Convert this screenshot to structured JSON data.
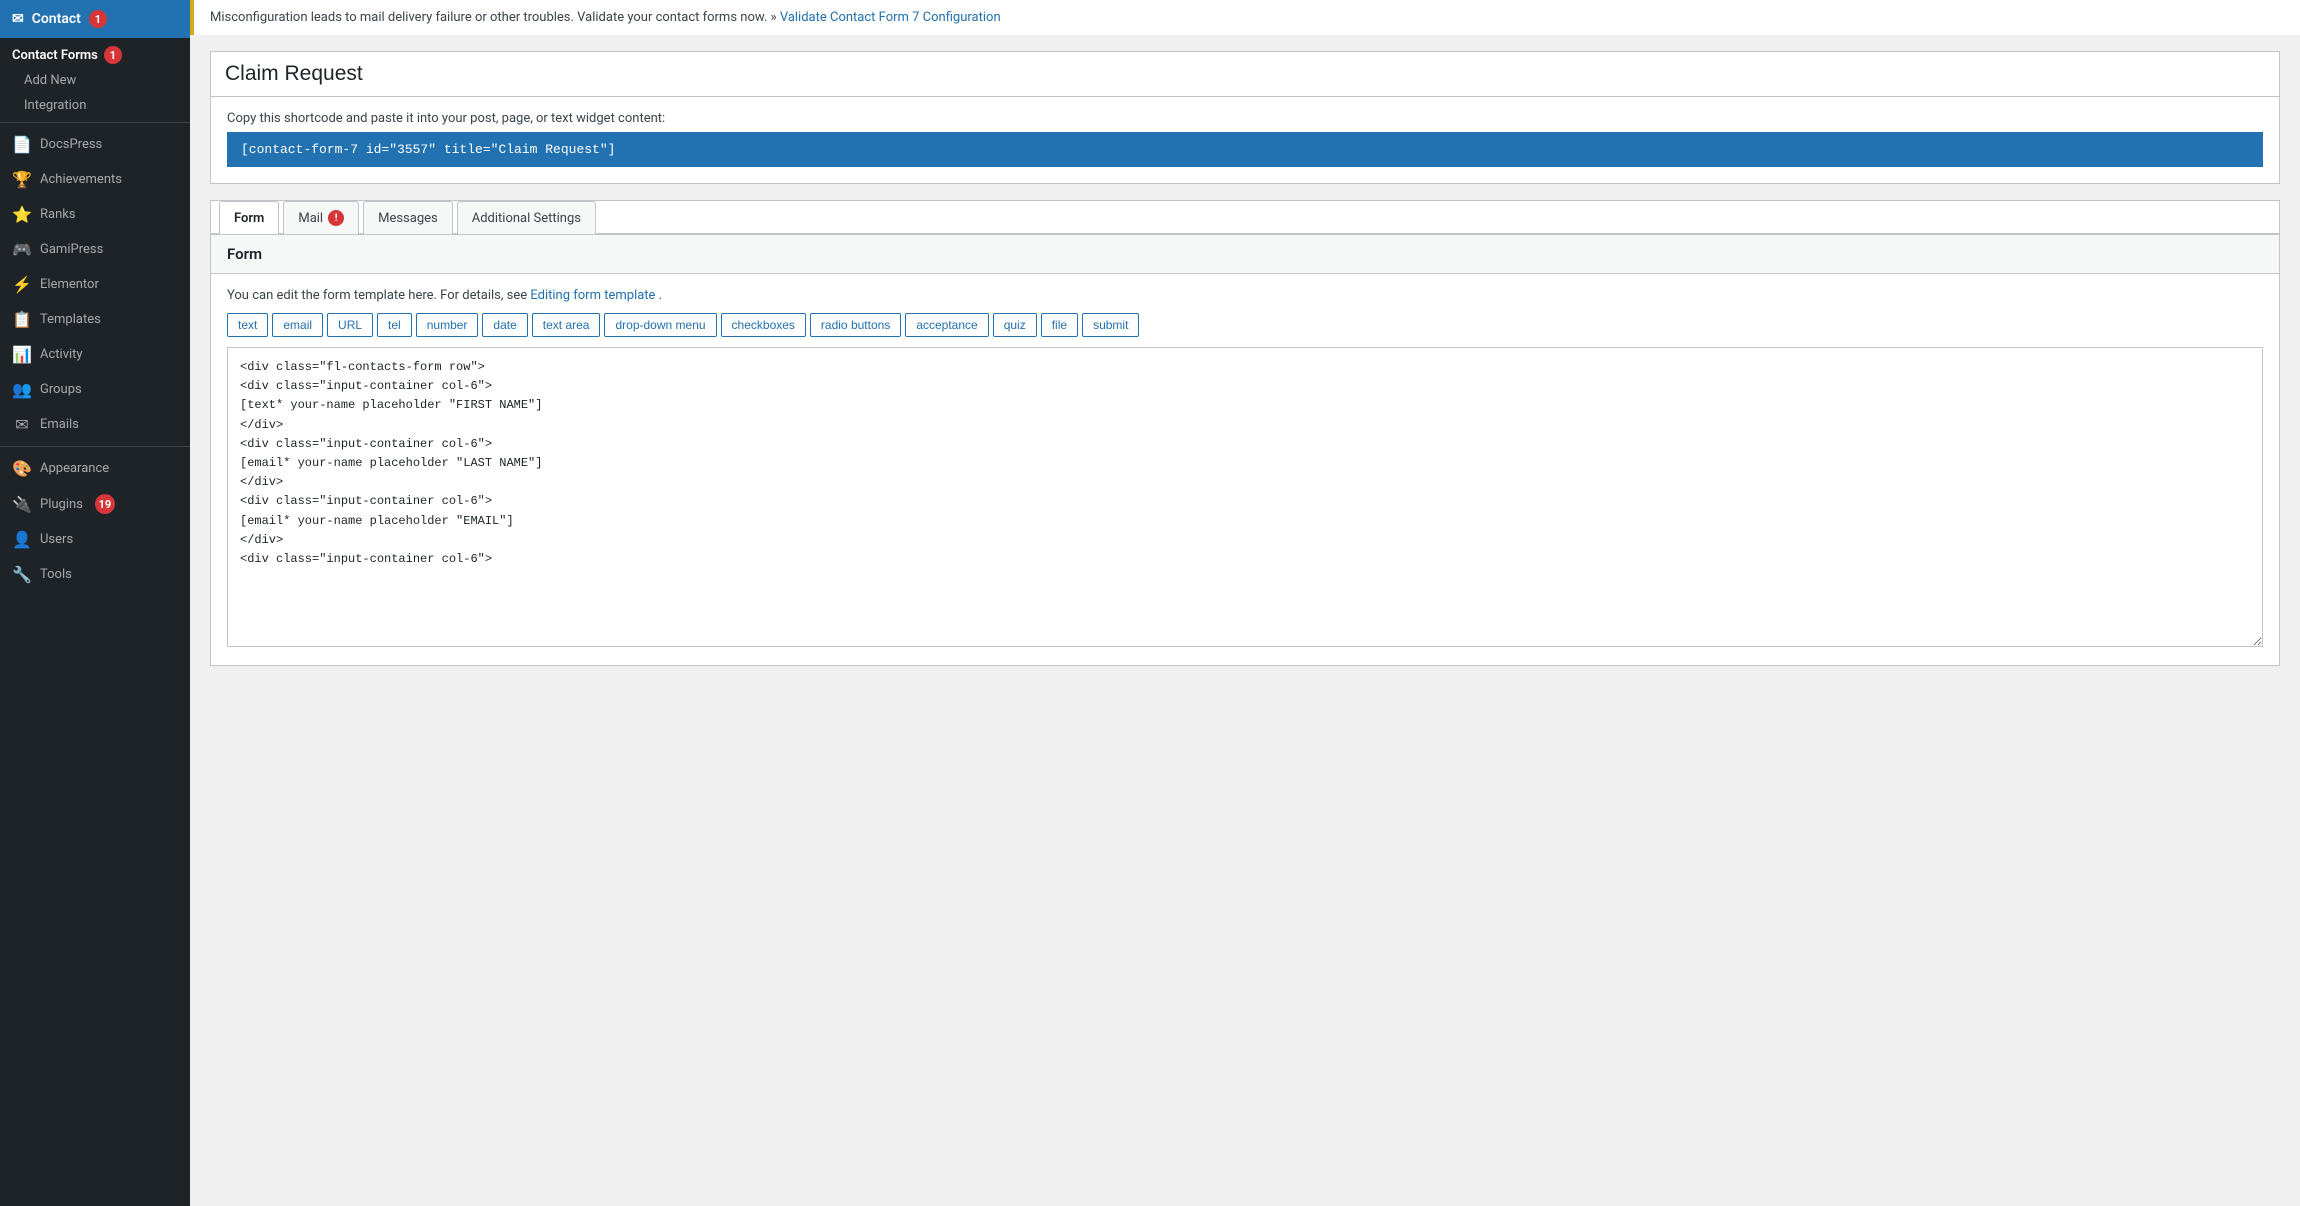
{
  "sidebar": {
    "header": {
      "icon": "✉",
      "label": "Contact",
      "badge": "1"
    },
    "contact_forms": {
      "label": "Contact Forms",
      "badge": "1"
    },
    "sub_items": [
      {
        "label": "Add New"
      },
      {
        "label": "Integration"
      }
    ],
    "items": [
      {
        "id": "docspress",
        "icon": "📄",
        "label": "DocsPress"
      },
      {
        "id": "achievements",
        "icon": "🏆",
        "label": "Achievements"
      },
      {
        "id": "ranks",
        "icon": "⭐",
        "label": "Ranks"
      },
      {
        "id": "gamipress",
        "icon": "🎮",
        "label": "GamiPress"
      },
      {
        "id": "elementor",
        "icon": "⚡",
        "label": "Elementor"
      },
      {
        "id": "templates",
        "icon": "📋",
        "label": "Templates"
      },
      {
        "id": "activity",
        "icon": "📊",
        "label": "Activity"
      },
      {
        "id": "groups",
        "icon": "👥",
        "label": "Groups"
      },
      {
        "id": "emails",
        "icon": "✉",
        "label": "Emails"
      },
      {
        "id": "appearance",
        "icon": "🎨",
        "label": "Appearance"
      },
      {
        "id": "plugins",
        "icon": "🔌",
        "label": "Plugins",
        "badge": "19"
      },
      {
        "id": "users",
        "icon": "👤",
        "label": "Users"
      },
      {
        "id": "tools",
        "icon": "🔧",
        "label": "Tools"
      }
    ]
  },
  "warning": {
    "text": "Misconfiguration leads to mail delivery failure or other troubles. Validate your contact forms now. »",
    "link_text": "Validate Contact Form 7 Configuration",
    "link_href": "#"
  },
  "form": {
    "title": "Claim Request",
    "shortcode_label": "Copy this shortcode and paste it into your post, page, or text widget content:",
    "shortcode_value": "[contact-form-7 id=\"3557\" title=\"Claim Request\"]"
  },
  "tabs": [
    {
      "id": "form",
      "label": "Form",
      "active": true,
      "badge": null
    },
    {
      "id": "mail",
      "label": "Mail",
      "active": false,
      "badge": "!"
    },
    {
      "id": "messages",
      "label": "Messages",
      "active": false,
      "badge": null
    },
    {
      "id": "additional-settings",
      "label": "Additional Settings",
      "active": false,
      "badge": null
    }
  ],
  "form_tab": {
    "section_title": "Form",
    "description_pre": "You can edit the form template here. For details, see",
    "description_link": "Editing form template",
    "description_post": ".",
    "tag_buttons": [
      "text",
      "email",
      "URL",
      "tel",
      "number",
      "date",
      "text area",
      "drop-down menu",
      "checkboxes",
      "radio buttons",
      "acceptance",
      "quiz",
      "file",
      "submit"
    ],
    "code_content": "<div class=\"fl-contacts-form row\">\n<div class=\"input-container col-6\">\n[text* your-name placeholder \"FIRST NAME\"]\n</div>\n<div class=\"input-container col-6\">\n[email* your-name placeholder \"LAST NAME\"]\n</div>\n<div class=\"input-container col-6\">\n[email* your-name placeholder \"EMAIL\"]\n</div>\n<div class=\"input-container col-6\">"
  }
}
